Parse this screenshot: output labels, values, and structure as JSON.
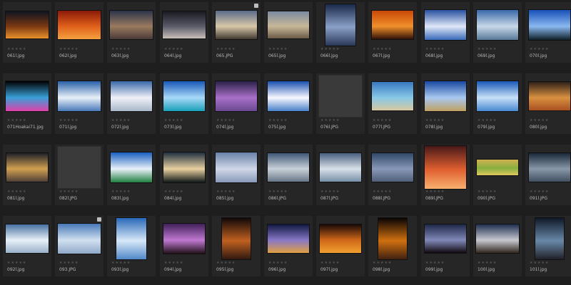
{
  "rating_glyphs": "★★★★★",
  "lock_glyph": "🔒",
  "thumbnails": [
    {
      "name": "061l.jpg",
      "w": 60,
      "h": 38,
      "colors": [
        "#0e1420",
        "#7a3812",
        "#e8902a"
      ]
    },
    {
      "name": "062l.jpg",
      "w": 60,
      "h": 40,
      "colors": [
        "#8a1a08",
        "#e0601a",
        "#f5a040"
      ]
    },
    {
      "name": "063l.jpg",
      "w": 60,
      "h": 40,
      "colors": [
        "#2a3448",
        "#9a7a60",
        "#4a3a38"
      ]
    },
    {
      "name": "064l.jpg",
      "w": 60,
      "h": 38,
      "colors": [
        "#1a1a22",
        "#5a5a68",
        "#c8c0b8"
      ]
    },
    {
      "name": "065.JPG",
      "w": 58,
      "h": 40,
      "colors": [
        "#5a6a88",
        "#d8c8a8",
        "#403830"
      ],
      "locked": true
    },
    {
      "name": "065l.jpg",
      "w": 58,
      "h": 38,
      "colors": [
        "#7a8aa0",
        "#c8b898",
        "#6a5a48"
      ]
    },
    {
      "name": "066l.jpg",
      "w": 42,
      "h": 58,
      "colors": [
        "#1a2848",
        "#8aa0c8",
        "#2a3858"
      ]
    },
    {
      "name": "067l.jpg",
      "w": 58,
      "h": 40,
      "colors": [
        "#c84808",
        "#f0902a",
        "#301008"
      ]
    },
    {
      "name": "068l.jpg",
      "w": 58,
      "h": 42,
      "colors": [
        "#2850a0",
        "#e0e8f8",
        "#3868b8"
      ]
    },
    {
      "name": "069l.jpg",
      "w": 58,
      "h": 42,
      "colors": [
        "#3868a8",
        "#c8d8e8",
        "#587898"
      ]
    },
    {
      "name": "070l.jpg",
      "w": 58,
      "h": 42,
      "colors": [
        "#1850b8",
        "#8ab8f0",
        "#102028"
      ]
    },
    {
      "name": "071Hoakai71.jpg",
      "w": 60,
      "h": 42,
      "colors": [
        "#000000",
        "#3aa0d8",
        "#e040a8"
      ]
    },
    {
      "name": "071l.jpg",
      "w": 60,
      "h": 42,
      "colors": [
        "#2860a8",
        "#e8f0f8",
        "#4878b8"
      ]
    },
    {
      "name": "072l.jpg",
      "w": 58,
      "h": 42,
      "colors": [
        "#3868a8",
        "#f0f0f8",
        "#a8b8c8"
      ]
    },
    {
      "name": "073l.jpg",
      "w": 58,
      "h": 42,
      "colors": [
        "#1858b8",
        "#a8d8f8",
        "#18a0b8"
      ]
    },
    {
      "name": "074l.jpg",
      "w": 58,
      "h": 42,
      "colors": [
        "#2a2048",
        "#a870c8",
        "#6a4890"
      ]
    },
    {
      "name": "075l.jpg",
      "w": 58,
      "h": 42,
      "colors": [
        "#1850b0",
        "#f8f8ff",
        "#4880c8"
      ]
    },
    {
      "name": "076l.JPG",
      "w": 60,
      "h": 58,
      "blank": true
    },
    {
      "name": "077l.JPG",
      "w": 58,
      "h": 40,
      "colors": [
        "#3878c0",
        "#88c8e8",
        "#d8c8a0"
      ]
    },
    {
      "name": "078l.jpg",
      "w": 58,
      "h": 42,
      "colors": [
        "#1848a0",
        "#a8c8f0",
        "#c0a060"
      ]
    },
    {
      "name": "079l.jpg",
      "w": 58,
      "h": 42,
      "colors": [
        "#1858b8",
        "#c8e0f8",
        "#4888d0"
      ]
    },
    {
      "name": "080l.jpg",
      "w": 58,
      "h": 40,
      "colors": [
        "#302018",
        "#d89040",
        "#a85020"
      ]
    },
    {
      "name": "081l.jpg",
      "w": 58,
      "h": 40,
      "colors": [
        "#202028",
        "#d0a050",
        "#504038"
      ]
    },
    {
      "name": "082l.JPG",
      "w": 60,
      "h": 58,
      "blank": true
    },
    {
      "name": "083l.jpg",
      "w": 58,
      "h": 42,
      "colors": [
        "#1860c0",
        "#e8f0f8",
        "#208040"
      ]
    },
    {
      "name": "084l.jpg",
      "w": 58,
      "h": 42,
      "colors": [
        "#203040",
        "#e8d0a0",
        "#101818"
      ]
    },
    {
      "name": "085l.jpg",
      "w": 58,
      "h": 42,
      "colors": [
        "#6880a8",
        "#d0d8e8",
        "#8898b8"
      ]
    },
    {
      "name": "086l.JPG",
      "w": 58,
      "h": 40,
      "colors": [
        "#405878",
        "#c8d0d8",
        "#687888"
      ]
    },
    {
      "name": "087l.JPG",
      "w": 58,
      "h": 40,
      "colors": [
        "#4a6080",
        "#d8e0e8",
        "#7890a8"
      ]
    },
    {
      "name": "088l.JPG",
      "w": 58,
      "h": 40,
      "colors": [
        "#304868",
        "#8898b8",
        "#506078"
      ]
    },
    {
      "name": "089l.JPG",
      "w": 58,
      "h": 60,
      "colors": [
        "#481818",
        "#e06030",
        "#f8b070"
      ]
    },
    {
      "name": "090l.JPG",
      "w": 58,
      "h": 22,
      "colors": [
        "#d0b050",
        "#88b040",
        "#e0c860"
      ]
    },
    {
      "name": "091l.JPG",
      "w": 58,
      "h": 40,
      "colors": [
        "#182838",
        "#8898a8",
        "#405060"
      ]
    },
    {
      "name": "092l.jpg",
      "w": 60,
      "h": 40,
      "colors": [
        "#4870a0",
        "#e8f0f8",
        "#98b0c8"
      ]
    },
    {
      "name": "093.JPG",
      "w": 60,
      "h": 42,
      "colors": [
        "#4878b8",
        "#d0e0f0",
        "#90a8c8"
      ],
      "locked": true
    },
    {
      "name": "093l.jpg",
      "w": 42,
      "h": 58,
      "colors": [
        "#2868b8",
        "#d8e8f8",
        "#5088c8"
      ]
    },
    {
      "name": "094l.jpg",
      "w": 58,
      "h": 42,
      "colors": [
        "#40205a",
        "#c078d0",
        "#201018"
      ]
    },
    {
      "name": "095l.jpg",
      "w": 40,
      "h": 58,
      "colors": [
        "#100808",
        "#c06020",
        "#301810"
      ]
    },
    {
      "name": "096l.jpg",
      "w": 58,
      "h": 40,
      "colors": [
        "#101840",
        "#8878c8",
        "#e0a040"
      ]
    },
    {
      "name": "097l.jpg",
      "w": 58,
      "h": 40,
      "colors": [
        "#180808",
        "#d06818",
        "#f0a030"
      ]
    },
    {
      "name": "098l.jpg",
      "w": 40,
      "h": 58,
      "colors": [
        "#080404",
        "#d07010",
        "#402010"
      ]
    },
    {
      "name": "099l.jpg",
      "w": 58,
      "h": 40,
      "colors": [
        "#202848",
        "#8088b8",
        "#100810"
      ]
    },
    {
      "name": "100l.jpg",
      "w": 60,
      "h": 40,
      "colors": [
        "#203050",
        "#c8c8d0",
        "#302820"
      ]
    },
    {
      "name": "101l.jpg",
      "w": 40,
      "h": 58,
      "colors": [
        "#101828",
        "#6888a8",
        "#202028"
      ]
    }
  ]
}
